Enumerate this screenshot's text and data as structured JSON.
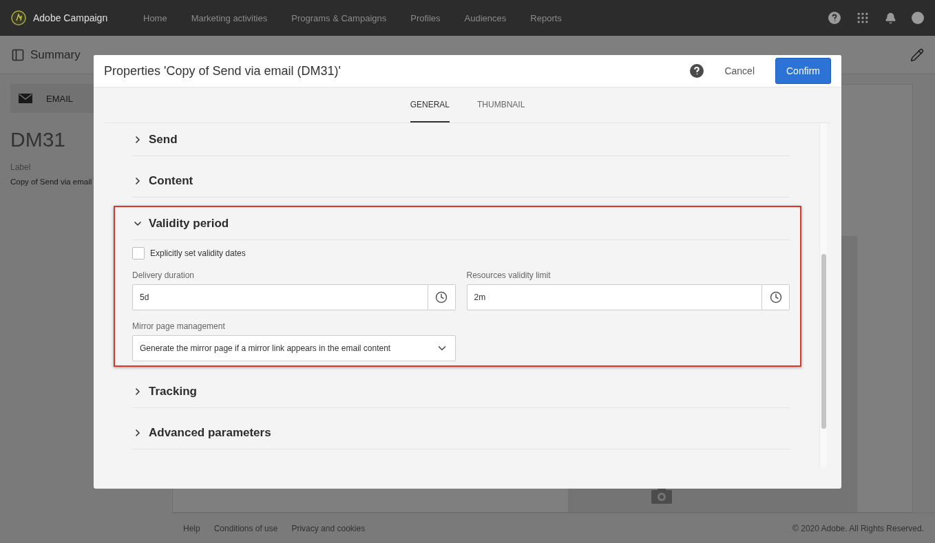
{
  "nav": {
    "brand": "Adobe Campaign",
    "items": [
      "Home",
      "Marketing activities",
      "Programs & Campaigns",
      "Profiles",
      "Audiences",
      "Reports"
    ]
  },
  "summary": {
    "title": "Summary"
  },
  "left_panel": {
    "tab": "EMAIL",
    "code": "DM31",
    "label_caption": "Label",
    "label_value": "Copy of Send via email"
  },
  "footer": {
    "links": [
      "Help",
      "Conditions of use",
      "Privacy and cookies"
    ],
    "copyright": "© 2020 Adobe. All Rights Reserved."
  },
  "dialog": {
    "title": "Properties 'Copy of Send via email (DM31)'",
    "cancel": "Cancel",
    "confirm": "Confirm",
    "tabs": [
      {
        "label": "GENERAL",
        "selected": true
      },
      {
        "label": "THUMBNAIL",
        "selected": false
      }
    ],
    "sections": [
      {
        "title": "Send",
        "expanded": false,
        "highlighted": false
      },
      {
        "title": "Content",
        "expanded": false,
        "highlighted": false
      },
      {
        "title": "Validity period",
        "expanded": true,
        "highlighted": true,
        "body": {
          "checkbox": {
            "label": "Explicitly set validity dates",
            "checked": false
          },
          "fields": [
            {
              "label": "Delivery duration",
              "value": "5d"
            },
            {
              "label": "Resources validity limit",
              "value": "2m"
            }
          ],
          "select": {
            "label": "Mirror page management",
            "value": "Generate the mirror page if a mirror link appears in the email content"
          }
        }
      },
      {
        "title": "Tracking",
        "expanded": false,
        "highlighted": false
      },
      {
        "title": "Advanced parameters",
        "expanded": false,
        "highlighted": false
      }
    ]
  }
}
